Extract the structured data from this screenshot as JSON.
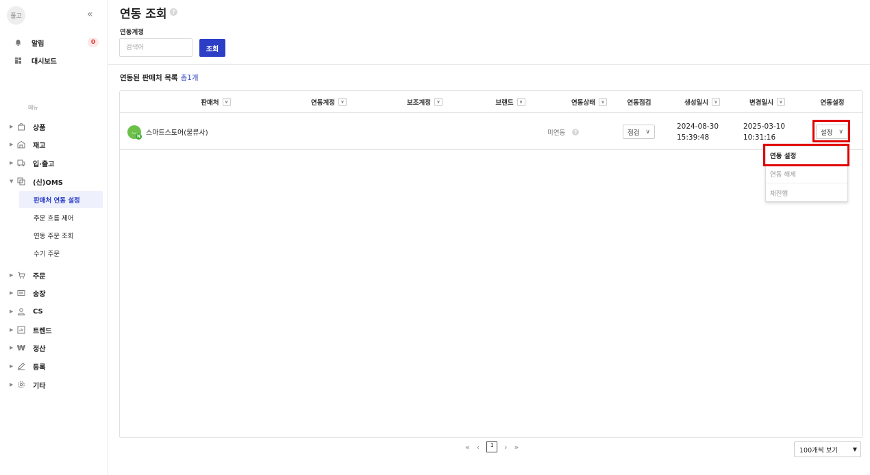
{
  "sidebar": {
    "logo_text": "풀고",
    "collapse_glyph": "«",
    "alert_label": "알림",
    "alert_count": "0",
    "dashboard_label": "대시보드",
    "menu_caption": "메뉴",
    "menu": [
      {
        "label": "상품",
        "icon": "bag-icon"
      },
      {
        "label": "재고",
        "icon": "warehouse-icon"
      },
      {
        "label": "입·출고",
        "icon": "truck-icon"
      },
      {
        "label": "(신)OMS",
        "icon": "oms-icon"
      }
    ],
    "submenu": [
      {
        "label": "판매처 연동 설정",
        "active": true
      },
      {
        "label": "주문 흐름 제어"
      },
      {
        "label": "연동 주문 조회"
      },
      {
        "label": "수기 주문"
      }
    ],
    "menu2": [
      {
        "label": "주문",
        "icon": "cart-icon"
      },
      {
        "label": "송장",
        "icon": "invoice-icon"
      },
      {
        "label": "CS",
        "icon": "person-icon"
      },
      {
        "label": "트렌드",
        "icon": "chart-icon"
      },
      {
        "label": "정산",
        "icon": "won-icon"
      },
      {
        "label": "등록",
        "icon": "pencil-icon"
      },
      {
        "label": "기타",
        "icon": "gear-icon"
      }
    ]
  },
  "header": {
    "title": "연동 조회",
    "filter_label": "연동계정",
    "search_placeholder": "검색어",
    "search_button": "조회"
  },
  "list": {
    "title": "연동된 판매처 목록",
    "count": "총1개"
  },
  "table": {
    "columns": [
      "판매처",
      "연동계정",
      "보조계정",
      "브랜드",
      "연동상태",
      "연동점검",
      "생성일시",
      "변경일시",
      "연동설정"
    ],
    "row": {
      "store": "스마트스토어(물류사)",
      "status": "미연동",
      "check_button": "점검",
      "created_date": "2024-08-30",
      "created_time": "15:39:48",
      "updated_date": "2025-03-10",
      "updated_time": "10:31:16",
      "setting_button": "설정"
    }
  },
  "dropdown": {
    "items": [
      "연동 설정",
      "연동 해제",
      "재전행"
    ]
  },
  "pagination": {
    "first": "«",
    "prev": "‹",
    "current": "1",
    "next": "›",
    "last": "»",
    "page_size": "100개씩 보기"
  },
  "colors": {
    "accent": "#2c3ec6",
    "highlight": "#e00000",
    "badge": "#e03030"
  }
}
